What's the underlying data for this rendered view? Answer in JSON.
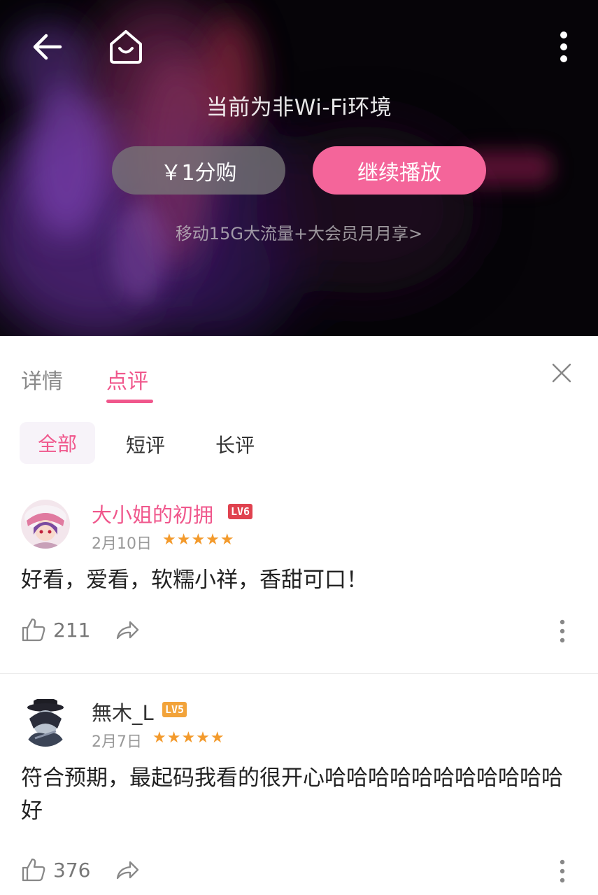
{
  "player": {
    "network_notice": "当前为非Wi-Fi环境",
    "pay_button": "￥1分购",
    "continue_button": "继续播放",
    "promo_link": "移动15G大流量+大会员月月享>"
  },
  "tabs": [
    {
      "label": "详情",
      "active": false
    },
    {
      "label": "点评",
      "active": true
    }
  ],
  "filters": [
    {
      "label": "全部",
      "active": true
    },
    {
      "label": "短评",
      "active": false
    },
    {
      "label": "长评",
      "active": false
    }
  ],
  "comments": [
    {
      "username": "大小姐的初拥",
      "username_color": "#f0578c",
      "level": "LV6",
      "level_color": "#e0424f",
      "date": "2月10日",
      "stars": 5,
      "stars_text": "★★★★★",
      "text": "好看，爱看，软糯小祥，香甜可口！",
      "likes": "211"
    },
    {
      "username": "無木_L",
      "username_color": "#333333",
      "level": "LV5",
      "level_color": "#f2a33a",
      "date": "2月7日",
      "stars": 5,
      "stars_text": "★★★★★",
      "text": "符合预期，最起码我看的很开心哈哈哈哈哈哈哈哈哈哈哈好",
      "likes": "376"
    }
  ],
  "colors": {
    "accent": "#f0578c",
    "play_button": "#f4659a",
    "star": "#f39a2c"
  },
  "icons": [
    "back-arrow-icon",
    "home-icon",
    "more-vertical-icon",
    "close-icon",
    "thumbs-up-icon",
    "share-icon"
  ]
}
